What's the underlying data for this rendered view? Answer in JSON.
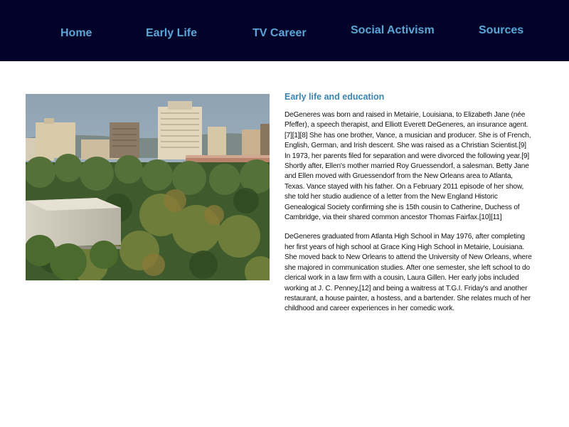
{
  "nav": {
    "home": "Home",
    "early_life": "Early Life",
    "tv_career": "TV Career",
    "social_activism": "Social Activism",
    "sources": "Sources"
  },
  "colors": {
    "nav_background": "#03032a",
    "nav_link": "#5aa6d6",
    "heading": "#3a84b4"
  },
  "article": {
    "heading": "Early life and education",
    "paragraphs": [
      "DeGeneres was born and raised in Metairie, Louisiana, to Elizabeth Jane (née Pfeffer), a speech therapist, and Elliott Everett DeGeneres, an insurance agent.[7][1][8] She has one brother, Vance, a musician and producer. She is of French, English, German, and Irish descent. She was raised as a Christian Scientist.[9] In 1973, her parents filed for separation and were divorced the following year.[9] Shortly after, Ellen's mother married Roy Gruessendorf, a salesman. Betty Jane and Ellen moved with Gruessendorf from the New Orleans area to Atlanta, Texas. Vance stayed with his father. On a February 2011 episode of her show, she told her studio audience of a letter from the New England Historic Genealogical Society confirming she is 15th cousin to Catherine, Duchess of Cambridge, via their shared common ancestor Thomas Fairfax.[10][11]",
      "DeGeneres graduated from Atlanta High School in May 1976, after completing her first years of high school at Grace King High School in Metairie, Louisiana. She moved back to New Orleans to attend the University of New Orleans, where she majored in communication studies. After one semester, she left school to do clerical work in a law firm with a cousin, Laura Gillen. Her early jobs included working at J. C. Penney,[12] and being a waitress at T.G.I. Friday's and another restaurant, a house painter, a hostess, and a bartender. She relates much of her childhood and career experiences in her comedic work."
    ]
  },
  "hero_image": {
    "subject": "city skyline above treetops"
  }
}
